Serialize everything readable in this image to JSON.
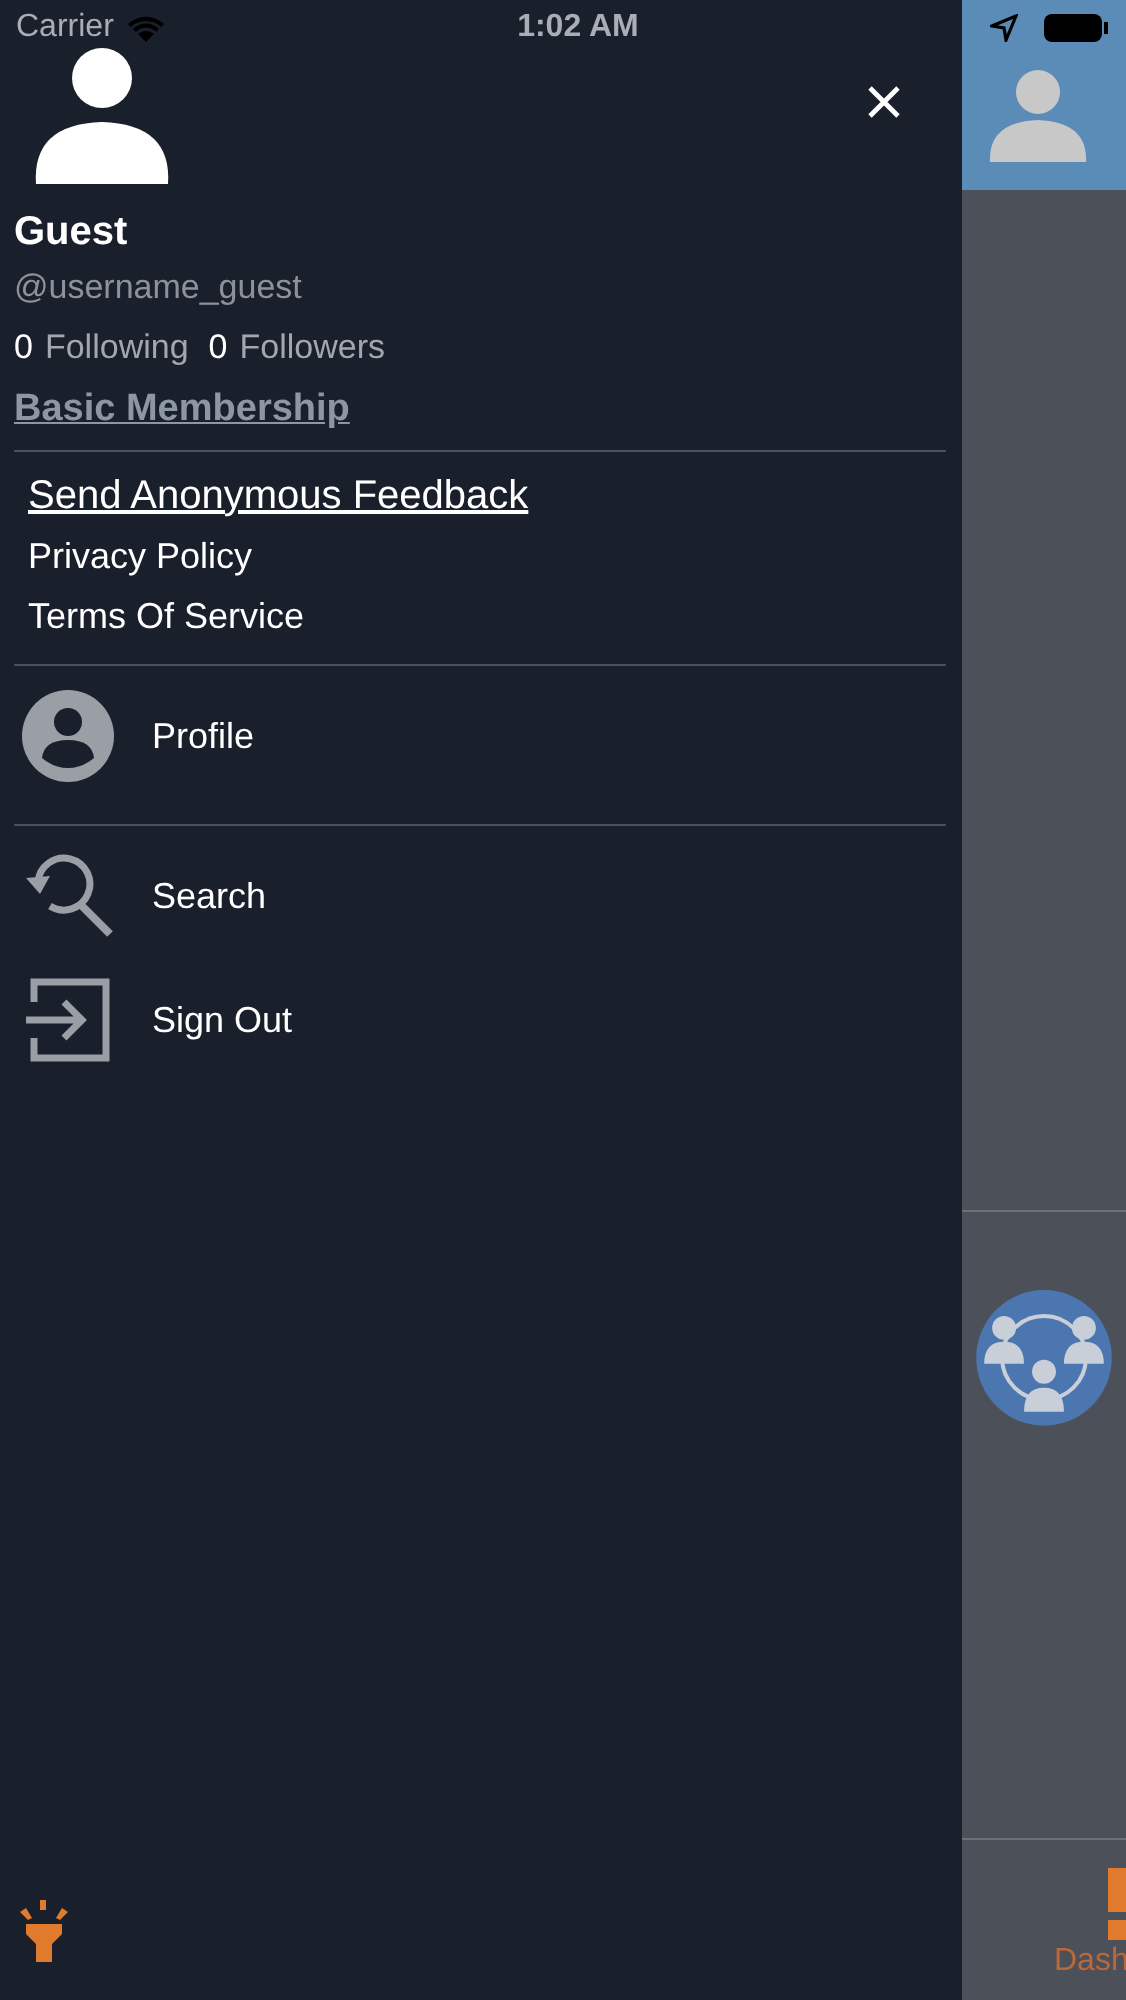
{
  "status_bar": {
    "carrier": "Carrier",
    "time": "1:02 AM"
  },
  "drawer": {
    "profile": {
      "name": "Guest",
      "username": "@username_guest",
      "following_count": "0",
      "following_label": "Following",
      "followers_count": "0",
      "followers_label": "Followers",
      "membership": "Basic Membership"
    },
    "links": [
      {
        "label": "Send Anonymous Feedback",
        "kind": "underlined"
      },
      {
        "label": "Privacy Policy",
        "kind": "plain"
      },
      {
        "label": "Terms Of Service",
        "kind": "plain"
      }
    ],
    "sections": [
      {
        "items": [
          {
            "label": "Profile",
            "kind": "person"
          }
        ]
      },
      {
        "items": [
          {
            "label": "Search",
            "kind": "search"
          },
          {
            "label": "Sign Out",
            "kind": "signout"
          }
        ]
      }
    ]
  },
  "background": {
    "tab_label": "Dash"
  }
}
